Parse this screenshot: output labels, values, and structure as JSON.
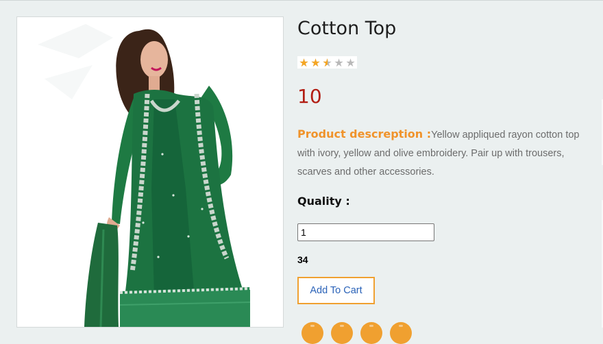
{
  "product": {
    "title": "Cotton Top",
    "rating": 2.5,
    "rating_max": 5,
    "price": "10",
    "description_label": "Product descreption :",
    "description": "Yellow appliqued rayon cotton top with ivory, yellow and olive embroidery. Pair up with trousers, scarves and other accessories.",
    "image": "woman-in-green-embroidered-anarkali-photo"
  },
  "quantity": {
    "label": "Quality :",
    "value": "1"
  },
  "stock": {
    "count": "34"
  },
  "actions": {
    "add_to_cart_label": "Add To Cart"
  },
  "share": {
    "icons": [
      "facebook-icon",
      "twitter-icon",
      "google-plus-icon",
      "linkedin-icon"
    ]
  },
  "colors": {
    "page_background": "#ebf0f0",
    "price": "#b21d12",
    "accent_orange": "#f0a030",
    "description_label": "#f0932b",
    "button_text": "#2a62b8",
    "star_filled": "#f5a623",
    "star_empty": "#b9b9b9"
  }
}
